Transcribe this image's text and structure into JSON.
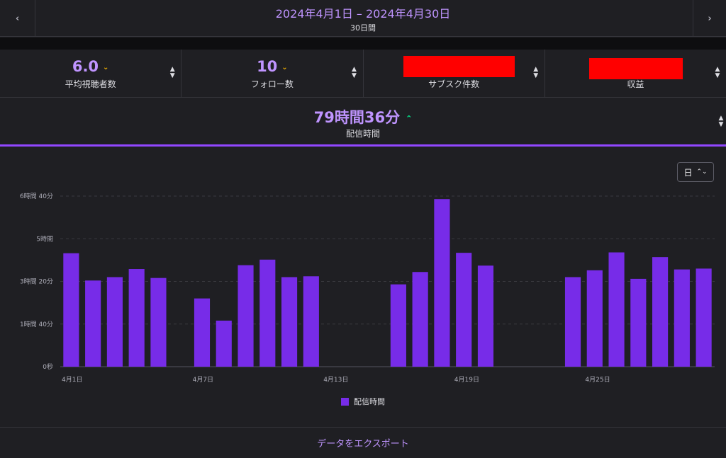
{
  "header": {
    "date_range": "2024年4月1日 – 2024年4月30日",
    "days": "30日間",
    "prev_icon": "chevron-left-icon",
    "next_icon": "chevron-right-icon"
  },
  "metrics": [
    {
      "value": "6.0",
      "label": "平均視聴者数",
      "trend": "down"
    },
    {
      "value": "10",
      "label": "フォロー数",
      "trend": "down"
    },
    {
      "value": "",
      "label": "サブスク件数",
      "redacted": true
    },
    {
      "value": "",
      "label": "収益",
      "redacted": true
    }
  ],
  "stream_metric": {
    "value": "79時間36分",
    "label": "配信時間",
    "trend": "up"
  },
  "colors": {
    "accent": "#9147ff",
    "bar": "#772ce8",
    "up": "#00f593",
    "down": "#f5b400",
    "text_purple": "#bf94ff"
  },
  "interval": {
    "label": "日"
  },
  "chart_data": {
    "type": "bar",
    "x": [
      "4月1日",
      "4月2日",
      "4月3日",
      "4月4日",
      "4月5日",
      "4月6日",
      "4月7日",
      "4月8日",
      "4月9日",
      "4月10日",
      "4月11日",
      "4月12日",
      "4月13日",
      "4月14日",
      "4月15日",
      "4月16日",
      "4月17日",
      "4月18日",
      "4月19日",
      "4月20日",
      "4月21日",
      "4月22日",
      "4月23日",
      "4月24日",
      "4月25日",
      "4月26日",
      "4月27日",
      "4月28日",
      "4月29日",
      "4月30日"
    ],
    "series": [
      {
        "name": "配信時間",
        "values_minutes": [
          266,
          202,
          210,
          229,
          208,
          0,
          160,
          108,
          238,
          251,
          210,
          212,
          0,
          0,
          0,
          193,
          222,
          393,
          267,
          237,
          0,
          0,
          0,
          210,
          226,
          268,
          206,
          257,
          0,
          0
        ]
      }
    ],
    "values_minutes_tail": [
      0,
      0,
      0,
      0,
      0,
      0,
      0,
      0,
      0,
      0,
      0,
      0,
      0,
      0,
      0,
      0,
      0,
      0,
      0,
      0,
      0,
      0,
      0,
      0,
      0,
      0,
      0,
      0,
      228,
      230
    ],
    "y_ticks_minutes": [
      0,
      100,
      200,
      300,
      400
    ],
    "y_tick_labels": [
      "0秒",
      "1時間 40分",
      "3時間 20分",
      "5時間",
      "6時間 40分"
    ],
    "x_tick_labels": [
      "4月1日",
      "4月7日",
      "4月13日",
      "4月19日",
      "4月25日"
    ],
    "ylim_minutes": [
      0,
      400
    ],
    "legend": "配信時間",
    "legend_position": "bottom",
    "grid": true
  },
  "footer": {
    "export_label": "データをエクスポート"
  }
}
